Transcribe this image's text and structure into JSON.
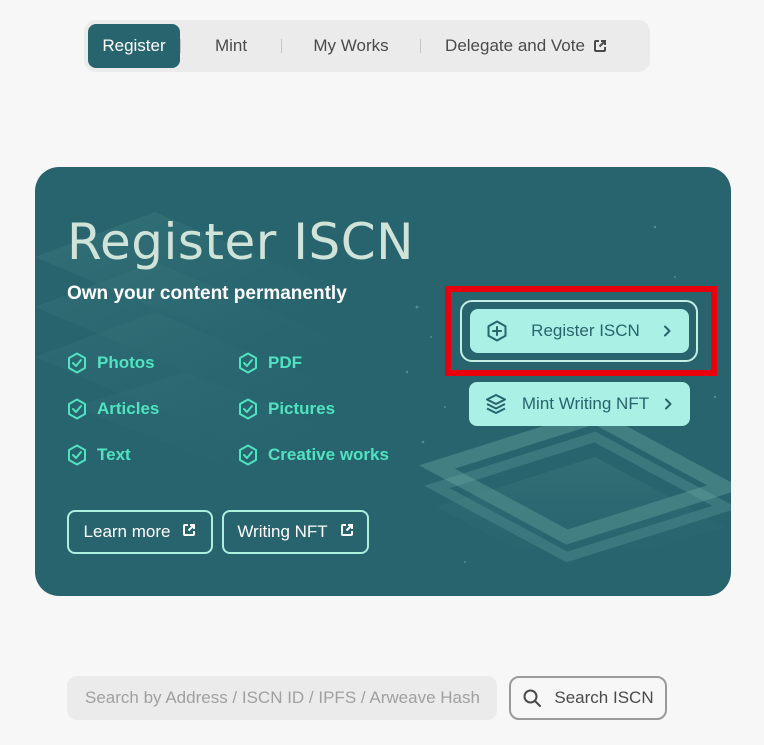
{
  "nav": {
    "tabs": [
      {
        "label": "Register",
        "active": true
      },
      {
        "label": "Mint",
        "active": false
      },
      {
        "label": "My Works",
        "active": false
      },
      {
        "label": "Delegate and Vote",
        "active": false,
        "icon": "external-link-icon"
      }
    ]
  },
  "hero": {
    "title": "Register ISCN",
    "subtitle": "Own your content permanently",
    "features": [
      "Photos",
      "PDF",
      "Articles",
      "Pictures",
      "Text",
      "Creative works"
    ],
    "feature_icon": "check-shield-icon",
    "links": [
      {
        "label": "Learn more",
        "icon": "external-link-icon"
      },
      {
        "label": "Writing NFT",
        "icon": "external-link-icon"
      }
    ],
    "actions": [
      {
        "label": "Register ISCN",
        "icon": "plus-hexagon-icon",
        "chevron": "chevron-right-icon"
      },
      {
        "label": "Mint Writing NFT",
        "icon": "layers-icon",
        "chevron": "chevron-right-icon"
      }
    ]
  },
  "search": {
    "placeholder": "Search by Address / ISCN ID / IPFS / Arweave Hash",
    "button_label": "Search ISCN",
    "button_icon": "search-icon"
  },
  "colors": {
    "brand": "#28646e",
    "accent": "#50e3c2",
    "cta": "#aaf0e5",
    "highlight": "#e8000c",
    "background": "#f7f7f7"
  }
}
